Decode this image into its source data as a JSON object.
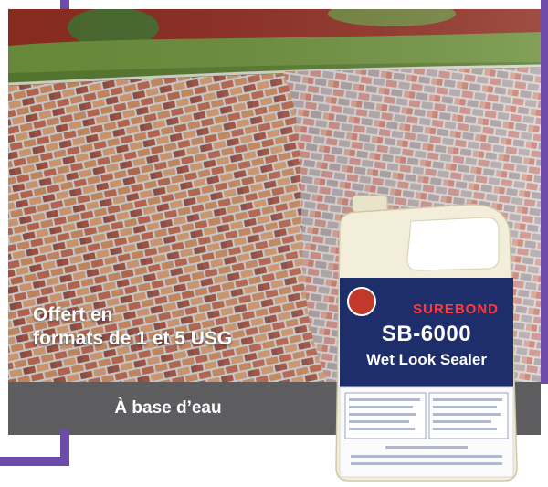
{
  "headline": {
    "line1": "Offert en",
    "line2": "formats de 1 et 5 USG"
  },
  "caption": {
    "text": "À base d’eau"
  },
  "product": {
    "brand": "SUREBOND",
    "model": "SB-6000",
    "name": "Wet Look Sealer"
  },
  "colors": {
    "frame": "#6d4ba8",
    "caption_bar": "#5d5d60",
    "label_navy": "#1d2e6b",
    "brand_red": "#ff3b3b"
  }
}
